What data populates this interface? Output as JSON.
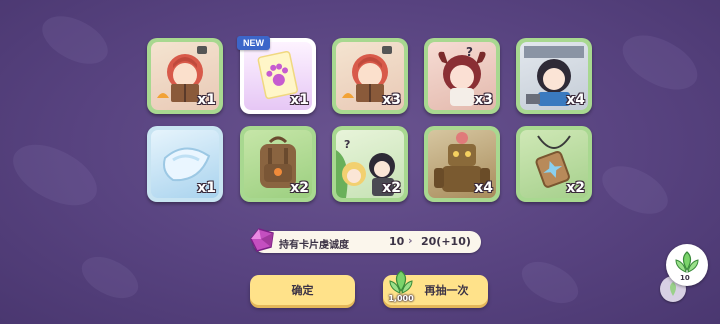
{
  "rewards": [
    {
      "name": "redhead-reading-book",
      "quantity": "x1",
      "isNew": false
    },
    {
      "name": "paw-print-card",
      "quantity": "x1",
      "isNew": true,
      "badge": "NEW"
    },
    {
      "name": "redhead-reading-book",
      "quantity": "x3",
      "isNew": false
    },
    {
      "name": "horned-girl-confused",
      "quantity": "x3",
      "isNew": false
    },
    {
      "name": "dark-hair-girl-desk",
      "quantity": "x4",
      "isNew": false
    },
    {
      "name": "crystal-crescent",
      "quantity": "x1",
      "isNew": false
    },
    {
      "name": "brown-backpack",
      "quantity": "x2",
      "isNew": false
    },
    {
      "name": "two-girls-scene",
      "quantity": "x2",
      "isNew": false
    },
    {
      "name": "wooden-golem",
      "quantity": "x4",
      "isNew": false
    },
    {
      "name": "pendant-necklace",
      "quantity": "x2",
      "isNew": false
    }
  ],
  "affinity": {
    "label": "持有卡片虔诚度",
    "current": "10",
    "arrow": "›",
    "new": "20(+10)"
  },
  "buttons": {
    "confirm": "确定",
    "draw_again": "再抽一次",
    "draw_cost": "1,000"
  },
  "side": {
    "count": "10"
  },
  "colors": {
    "background": "#584380",
    "card_border": "#a8d890",
    "button": "#ffe28a",
    "badge": "#3c66c9"
  }
}
